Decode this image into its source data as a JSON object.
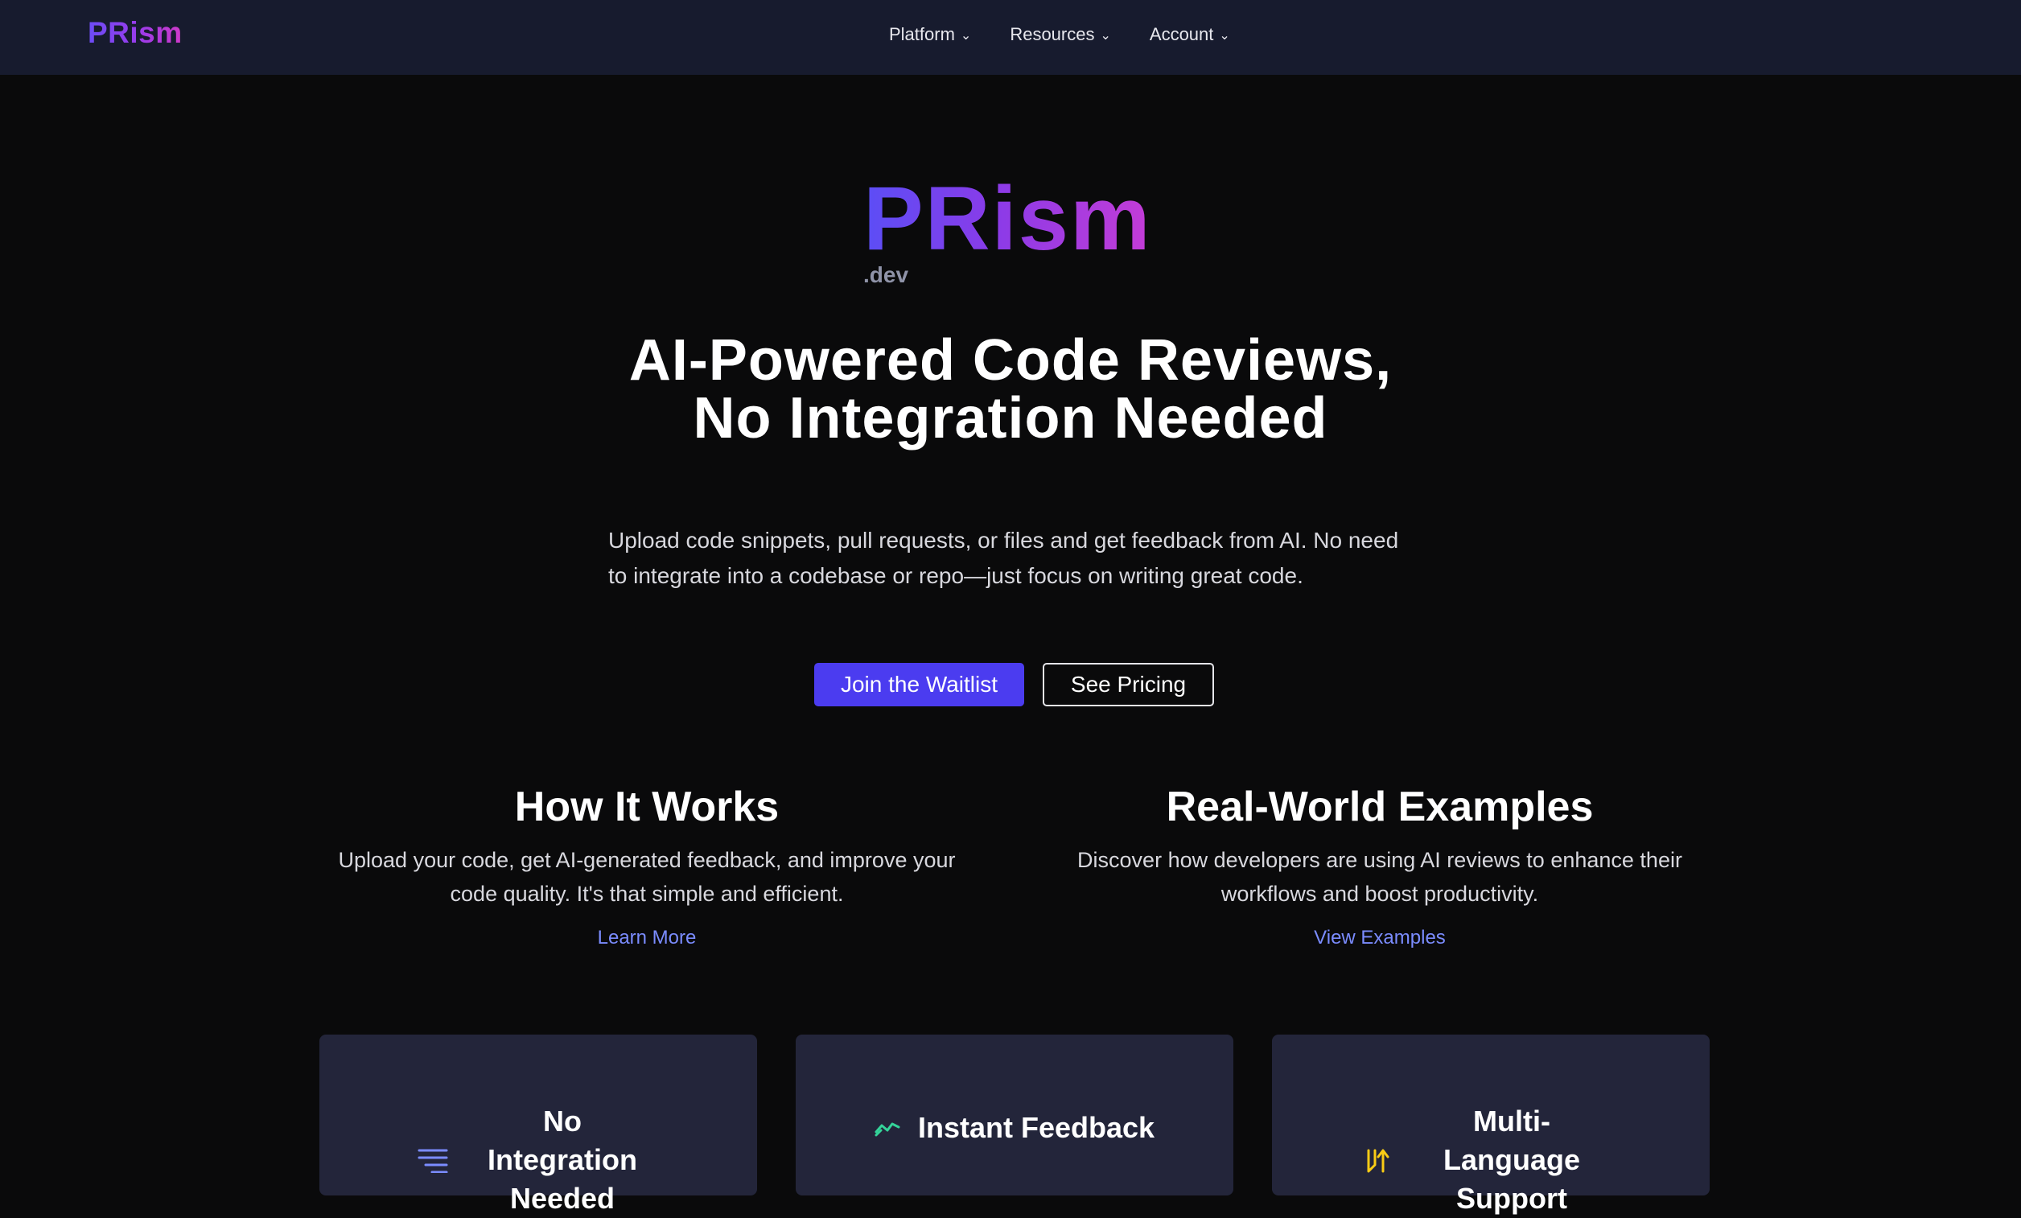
{
  "nav": {
    "logo": "PRism",
    "items": [
      {
        "label": "Platform"
      },
      {
        "label": "Resources"
      },
      {
        "label": "Account"
      }
    ]
  },
  "hero": {
    "logo": "PRism",
    "logo_suffix": ".dev",
    "headline": "AI-Powered Code Reviews, No Integration Needed",
    "subtext": "Upload code snippets, pull requests, or files and get feedback from AI. No need to integrate into a codebase or repo—just focus on writing great code.",
    "primary_button": "Join the Waitlist",
    "secondary_button": "See Pricing"
  },
  "info": {
    "how": {
      "title": "How It Works",
      "body": "Upload your code, get AI-generated feedback, and improve your code quality. It's that simple and efficient.",
      "link": "Learn More"
    },
    "examples": {
      "title": "Real-World Examples",
      "body": "Discover how developers are using AI reviews to enhance their workflows and boost productivity.",
      "link": "View Examples"
    }
  },
  "features": [
    {
      "title": "No Integration Needed",
      "icon": "list-lines-icon"
    },
    {
      "title": "Instant Feedback",
      "icon": "trend-line-icon"
    },
    {
      "title": "Multi-Language Support",
      "icon": "code-arrows-icon"
    }
  ],
  "colors": {
    "accent": "#4b3cf0",
    "link": "#7b8cff",
    "nav_bg": "#171b2e",
    "page_bg": "#0a0a0b",
    "card_bg": "#23253a"
  }
}
